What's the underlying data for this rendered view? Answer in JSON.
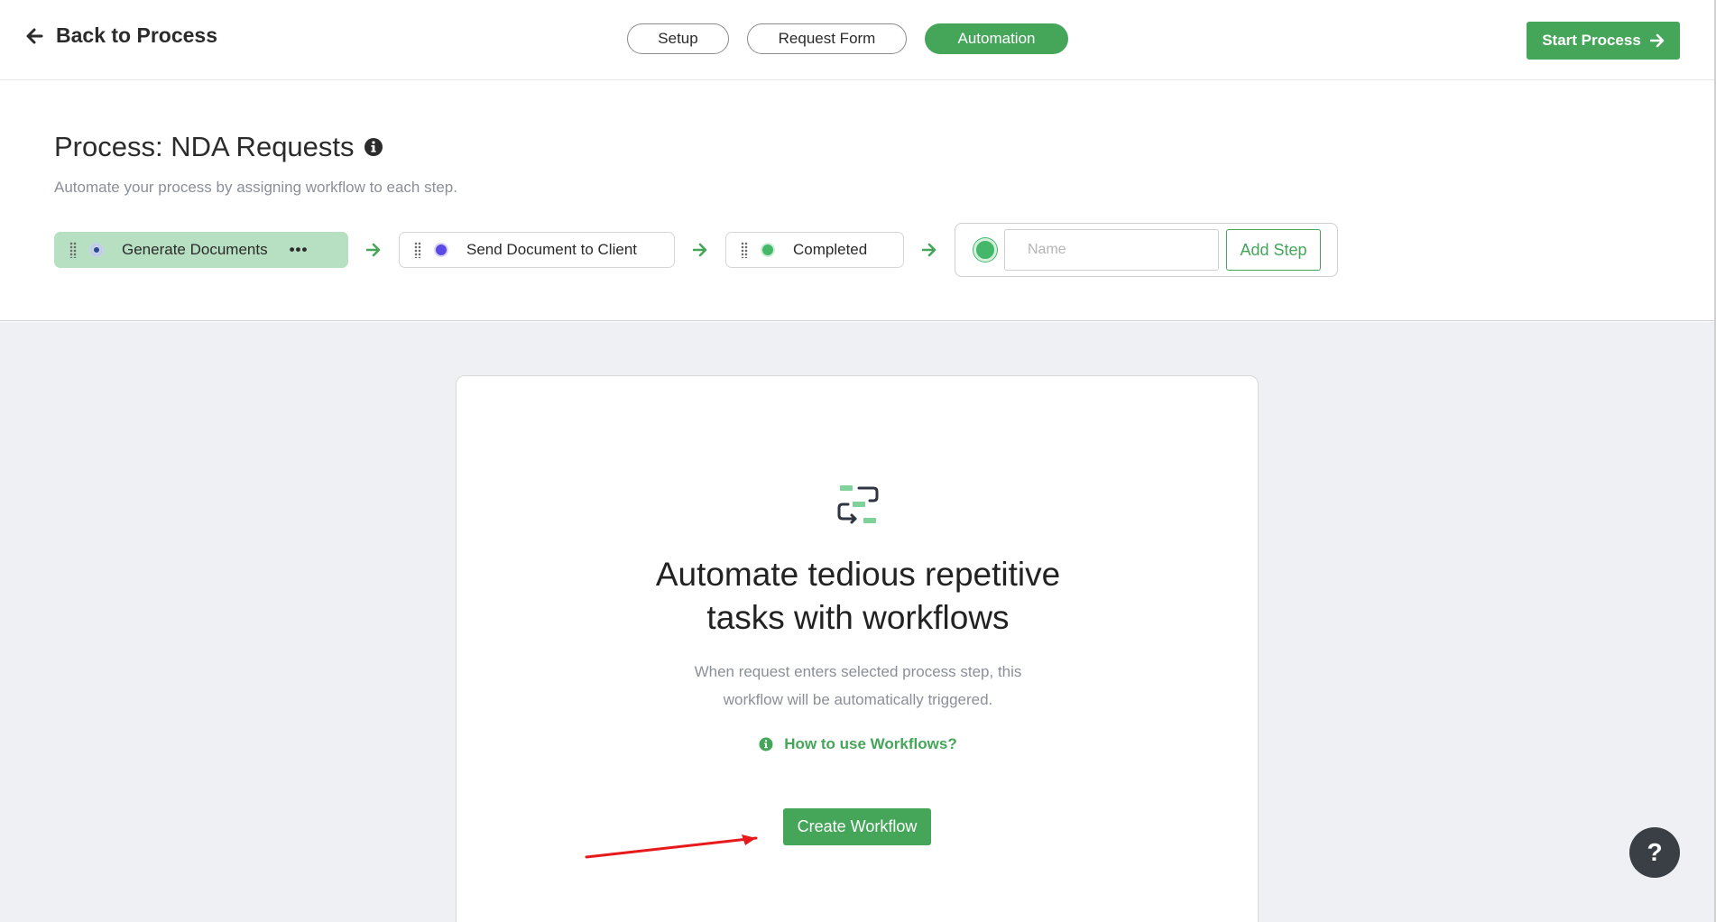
{
  "topbar": {
    "back_label": "Back to Process",
    "tabs": [
      {
        "label": "Setup",
        "active": false
      },
      {
        "label": "Request Form",
        "active": false
      },
      {
        "label": "Automation",
        "active": true
      }
    ],
    "start_label": "Start Process"
  },
  "process": {
    "title": "Process: NDA Requests",
    "subtitle": "Automate your process by assigning workflow to each step.",
    "steps": [
      {
        "label": "Generate Documents",
        "active": true,
        "dot_color": "#2b4a8a",
        "more": "•••"
      },
      {
        "label": "Send Document to Client",
        "active": false,
        "dot_color": "#5b49e8"
      },
      {
        "label": "Completed",
        "active": false,
        "dot_color": "#45b76a"
      }
    ],
    "new_step": {
      "name_placeholder": "Name",
      "add_label": "Add Step"
    }
  },
  "card": {
    "title_line1": "Automate tedious repetitive",
    "title_line2": "tasks with workflows",
    "sub_line1": "When request enters selected process step, this",
    "sub_line2": "workflow will be automatically triggered.",
    "howto_label": "How to use Workflows?",
    "create_label": "Create Workflow"
  },
  "help": {
    "label": "?"
  },
  "colors": {
    "accent": "#45a65a",
    "active_step_bg": "#b7dfc1",
    "annotation_arrow": "#e8191a"
  }
}
